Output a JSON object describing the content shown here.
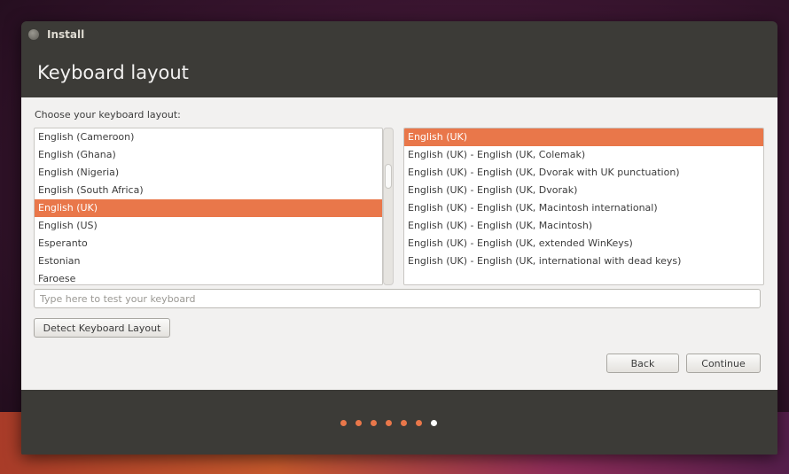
{
  "window": {
    "title": "Install"
  },
  "header": {
    "title": "Keyboard layout"
  },
  "layout": {
    "label": "Choose your keyboard layout:",
    "languages": [
      {
        "label": "English (Cameroon)",
        "selected": false
      },
      {
        "label": "English (Ghana)",
        "selected": false
      },
      {
        "label": "English (Nigeria)",
        "selected": false
      },
      {
        "label": "English (South Africa)",
        "selected": false
      },
      {
        "label": "English (UK)",
        "selected": true
      },
      {
        "label": "English (US)",
        "selected": false
      },
      {
        "label": "Esperanto",
        "selected": false
      },
      {
        "label": "Estonian",
        "selected": false
      },
      {
        "label": "Faroese",
        "selected": false
      }
    ],
    "variants": [
      {
        "label": "English (UK)",
        "selected": true
      },
      {
        "label": "English (UK) - English (UK, Colemak)",
        "selected": false
      },
      {
        "label": "English (UK) - English (UK, Dvorak with UK punctuation)",
        "selected": false
      },
      {
        "label": "English (UK) - English (UK, Dvorak)",
        "selected": false
      },
      {
        "label": "English (UK) - English (UK, Macintosh international)",
        "selected": false
      },
      {
        "label": "English (UK) - English (UK, Macintosh)",
        "selected": false
      },
      {
        "label": "English (UK) - English (UK, extended WinKeys)",
        "selected": false
      },
      {
        "label": "English (UK) - English (UK, international with dead keys)",
        "selected": false
      }
    ]
  },
  "test_input": {
    "placeholder": "Type here to test your keyboard",
    "value": ""
  },
  "buttons": {
    "detect": "Detect Keyboard Layout",
    "back": "Back",
    "continue": "Continue"
  },
  "progress": {
    "total_steps": 7,
    "current_step": 7,
    "done_color": "#e9774a",
    "current_color": "#ffffff"
  },
  "colors": {
    "accent": "#e9774a",
    "window_chrome": "#3c3b37",
    "content_bg": "#f2f1f0"
  }
}
